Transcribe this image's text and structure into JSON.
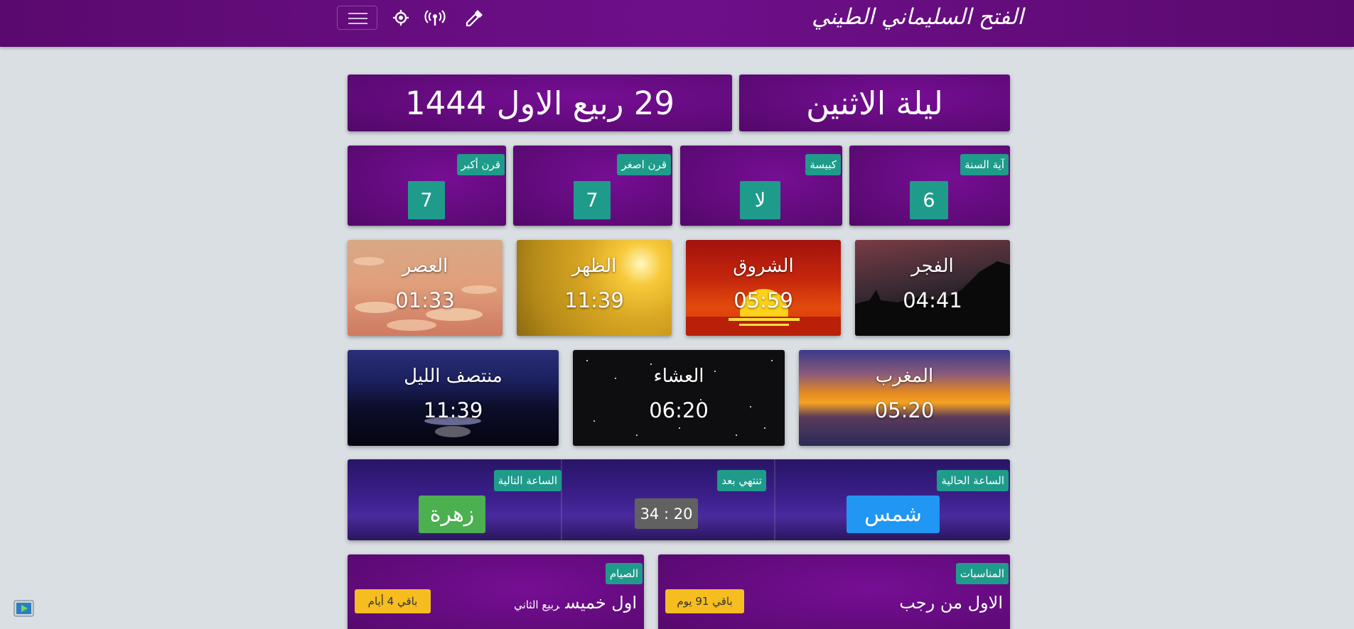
{
  "header": {
    "brand": "الفتح السليماني الطيني",
    "icons": [
      "menu-icon",
      "location-icon",
      "broadcast-icon",
      "eyedropper-icon"
    ]
  },
  "date": {
    "night": "ليلة الاثنين",
    "hijri": "29 ربيع الاول 1444"
  },
  "stats": [
    {
      "label": "آية السنة",
      "value": "6"
    },
    {
      "label": "كبيسة",
      "value": "لا"
    },
    {
      "label": "قرن اصغر",
      "value": "7"
    },
    {
      "label": "قرن أكبر",
      "value": "7"
    }
  ],
  "prayers": [
    {
      "name": "الفجر",
      "time": "04:41"
    },
    {
      "name": "الشروق",
      "time": "05:59"
    },
    {
      "name": "الظهر",
      "time": "11:39"
    },
    {
      "name": "العصر",
      "time": "01:33"
    },
    {
      "name": "المغرب",
      "time": "05:20"
    },
    {
      "name": "العشاء",
      "time": "06:20"
    },
    {
      "name": "منتصف الليل",
      "time": "11:39"
    }
  ],
  "hours": {
    "current_label": "الساعة الحالية",
    "current_value": "شمس",
    "ends_label": "تنتهي بعد",
    "ends_value": "34 : 20",
    "next_label": "الساعة التالية",
    "next_value": "زهرة",
    "colors": {
      "current": "#2196f3",
      "ends": "#616161",
      "next": "#4caf50"
    }
  },
  "occasions": {
    "label": "المناسبات",
    "title": "الاول من رجب",
    "remaining": "باقي 91 يوم"
  },
  "fasting": {
    "label": "الصيام",
    "title": "اول خميس",
    "subtitle": "ربيع الثاني",
    "remaining": "باقي 4 أيام"
  },
  "colors": {
    "brand_purple": "#6a0d85",
    "teal_tag": "#1f9b8b",
    "amber": "#f5bd1f",
    "page_bg": "#dadfe3"
  }
}
